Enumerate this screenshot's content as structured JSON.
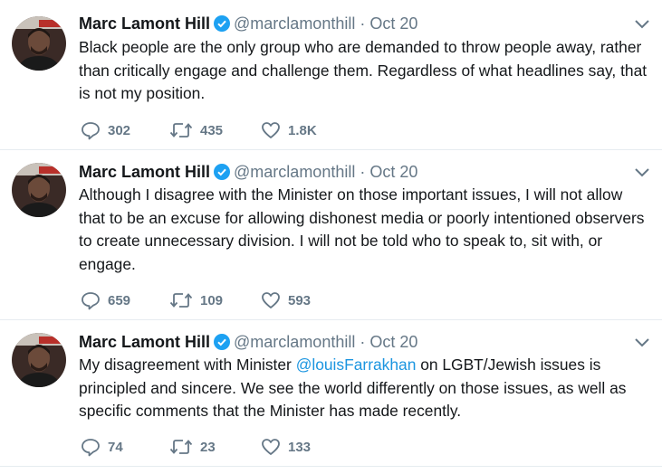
{
  "tweets": [
    {
      "name": "Marc Lamont Hill",
      "handle": "@marclamonthill",
      "separator": "·",
      "time": "Oct 20",
      "text": "Black people are the only group who are demanded to throw people away, rather than critically engage and challenge them. Regardless of what headlines say, that is not my position.",
      "replies": "302",
      "retweets": "435",
      "likes": "1.8K"
    },
    {
      "name": "Marc Lamont Hill",
      "handle": "@marclamonthill",
      "separator": "·",
      "time": "Oct 20",
      "text": "Although I disagree with the Minister on those important issues, I will not allow that to be an excuse for allowing dishonest media or poorly intentioned observers to create unnecessary division. I will not be told who to speak to, sit with, or engage.",
      "replies": "659",
      "retweets": "109",
      "likes": "593"
    },
    {
      "name": "Marc Lamont Hill",
      "handle": "@marclamonthill",
      "separator": "·",
      "time": "Oct 20",
      "text_before": "My disagreement with Minister ",
      "mention": "@louisFarrakhan",
      "text_after": " on LGBT/Jewish issues is principled and sincere. We see the world differently on those issues, as well as specific comments that the Minister has made recently.",
      "replies": "74",
      "retweets": "23",
      "likes": "133"
    }
  ],
  "icons": {
    "verified": "verified-badge-icon",
    "caret": "chevron-down-icon",
    "reply": "reply-icon",
    "retweet": "retweet-icon",
    "like": "heart-icon"
  },
  "colors": {
    "text": "#14171a",
    "secondary": "#657786",
    "link": "#1b95e0",
    "verified": "#1da1f2",
    "divider": "#e6ecf0"
  }
}
